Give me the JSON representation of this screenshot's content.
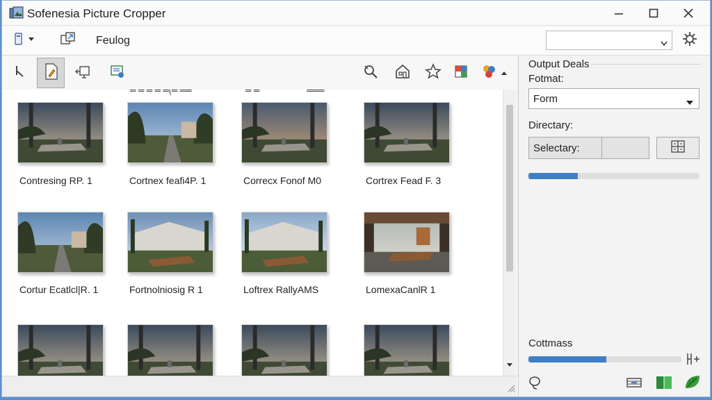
{
  "window": {
    "title": "Sofenesia Picture Cropper"
  },
  "toolbar": {
    "dialog_label": "Feulog",
    "combo_value": ""
  },
  "clipped_labels": [
    "═ ═ ═ ═ ═(═ ══",
    "═ ═",
    "═══"
  ],
  "grid": {
    "rows": [
      {
        "captions": [
          "Contresing RP. 1",
          "Cortnex feafi4P. 1",
          "Correcx Fonof M0",
          "Cortrex Fead F. 3"
        ],
        "scenes": [
          "table-sunset",
          "road-trees",
          "table-sunset-wide",
          "table-sunset"
        ]
      },
      {
        "captions": [
          "Cortur Ecatlcl|R. 1",
          "Fortnolniosig R 1",
          "Loftrex RallyAMS",
          "LomexaCanlR 1"
        ],
        "scenes": [
          "road-trees",
          "building-table",
          "building-table-wide",
          "interior-table"
        ]
      },
      {
        "captions": [
          "",
          "",
          "",
          ""
        ],
        "scenes": [
          "table-sunset",
          "table-sunset",
          "table-sunset",
          "table-sunset"
        ]
      }
    ]
  },
  "panel": {
    "heading": "Output Deals",
    "format_label": "Fotmat:",
    "format_value": "Form",
    "directory_label": "Directary:",
    "directory_value": "Selectary:",
    "directory_progress": 0.29,
    "compress_label": "Cottmass",
    "compress_value": 0.51
  },
  "colors": {
    "accent": "#3f7fc4",
    "window_border": "#5a8fd0",
    "active_tool": "#d7d7d7"
  },
  "icons": {
    "toolbar1": [
      "device-dropdown-icon",
      "crop-transform-icon",
      "settings-gear-icon"
    ],
    "toolbar2": [
      "pointer-icon",
      "edit-pen-icon",
      "transform-icon",
      "export-icon",
      "magnify-icon",
      "home-icon",
      "star-icon",
      "color-crop-icon",
      "palette-icon",
      "scroll-up-icon"
    ],
    "status": [
      "resize-grip-icon"
    ],
    "panel_bottom": [
      "lasso-icon",
      "film-icon",
      "book-icon",
      "leaf-icon"
    ]
  }
}
